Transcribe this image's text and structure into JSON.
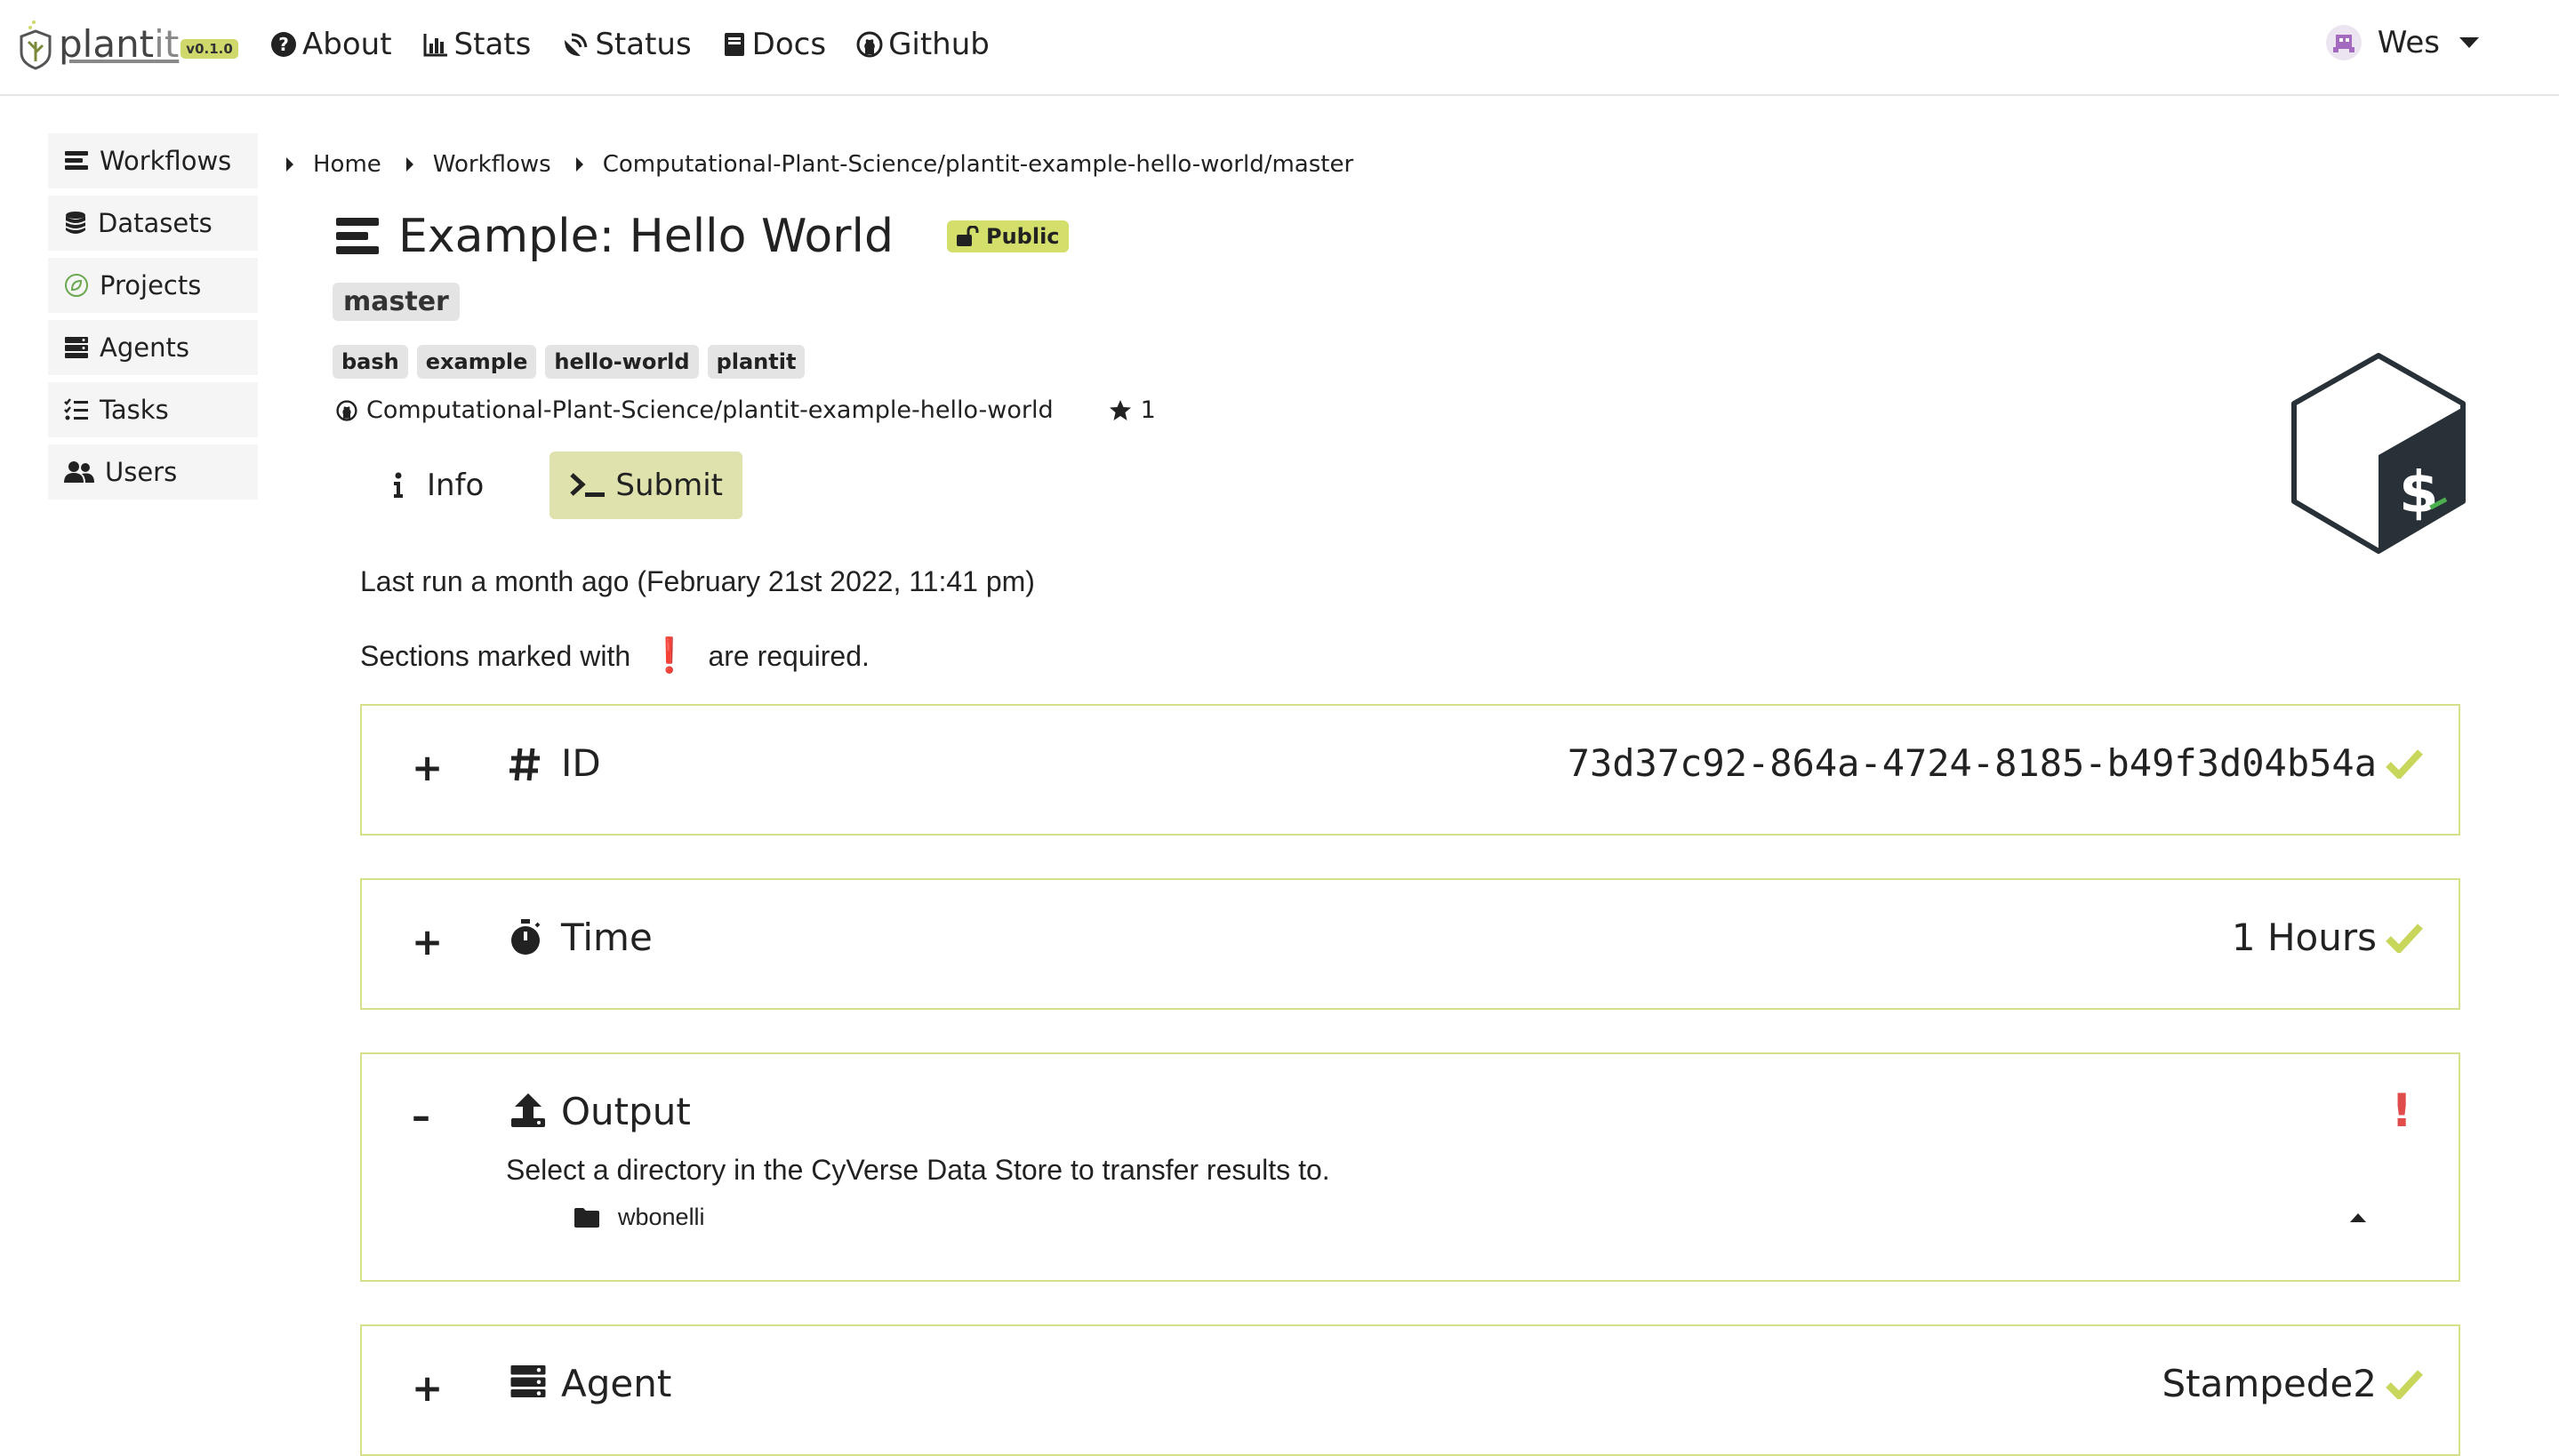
{
  "brand": {
    "name": "plant",
    "suffix": "it",
    "version": "v0.1.0"
  },
  "nav": {
    "links": [
      "About",
      "Stats",
      "Status",
      "Docs",
      "Github"
    ],
    "user": "Wes"
  },
  "sidebar": {
    "items": [
      "Workflows",
      "Datasets",
      "Projects",
      "Agents",
      "Tasks",
      "Users"
    ]
  },
  "breadcrumb": [
    "Home",
    "Workflows",
    "Computational-Plant-Science/plantit-example-hello-world/master"
  ],
  "workflow": {
    "title": "Example: Hello World",
    "visibility": "Public",
    "branch": "master",
    "tags": [
      "bash",
      "example",
      "hello-world",
      "plantit"
    ],
    "repo": "Computational-Plant-Science/plantit-example-hello-world",
    "stars": "1"
  },
  "tabs": [
    "Info",
    "Submit"
  ],
  "last_run": "Last run a month ago (February 21st 2022, 11:41 pm)",
  "required_note": {
    "before": "Sections marked with",
    "mark": "❗",
    "after": "are required."
  },
  "sections": {
    "id": {
      "toggle": "+",
      "title": "ID",
      "value": "73d37c92-864a-4724-8185-b49f3d04b54a"
    },
    "time": {
      "toggle": "+",
      "title": "Time",
      "value": "1 Hours"
    },
    "output": {
      "toggle": "–",
      "title": "Output",
      "description": "Select a directory in the CyVerse Data Store to transfer results to.",
      "directory": "wbonelli"
    },
    "agent": {
      "toggle": "+",
      "title": "Agent",
      "value": "Stampede2"
    }
  },
  "colors": {
    "accent": "#d3de6b",
    "check": "#c8d65c",
    "required": "#e04b4b",
    "border": "#d6e08a"
  }
}
